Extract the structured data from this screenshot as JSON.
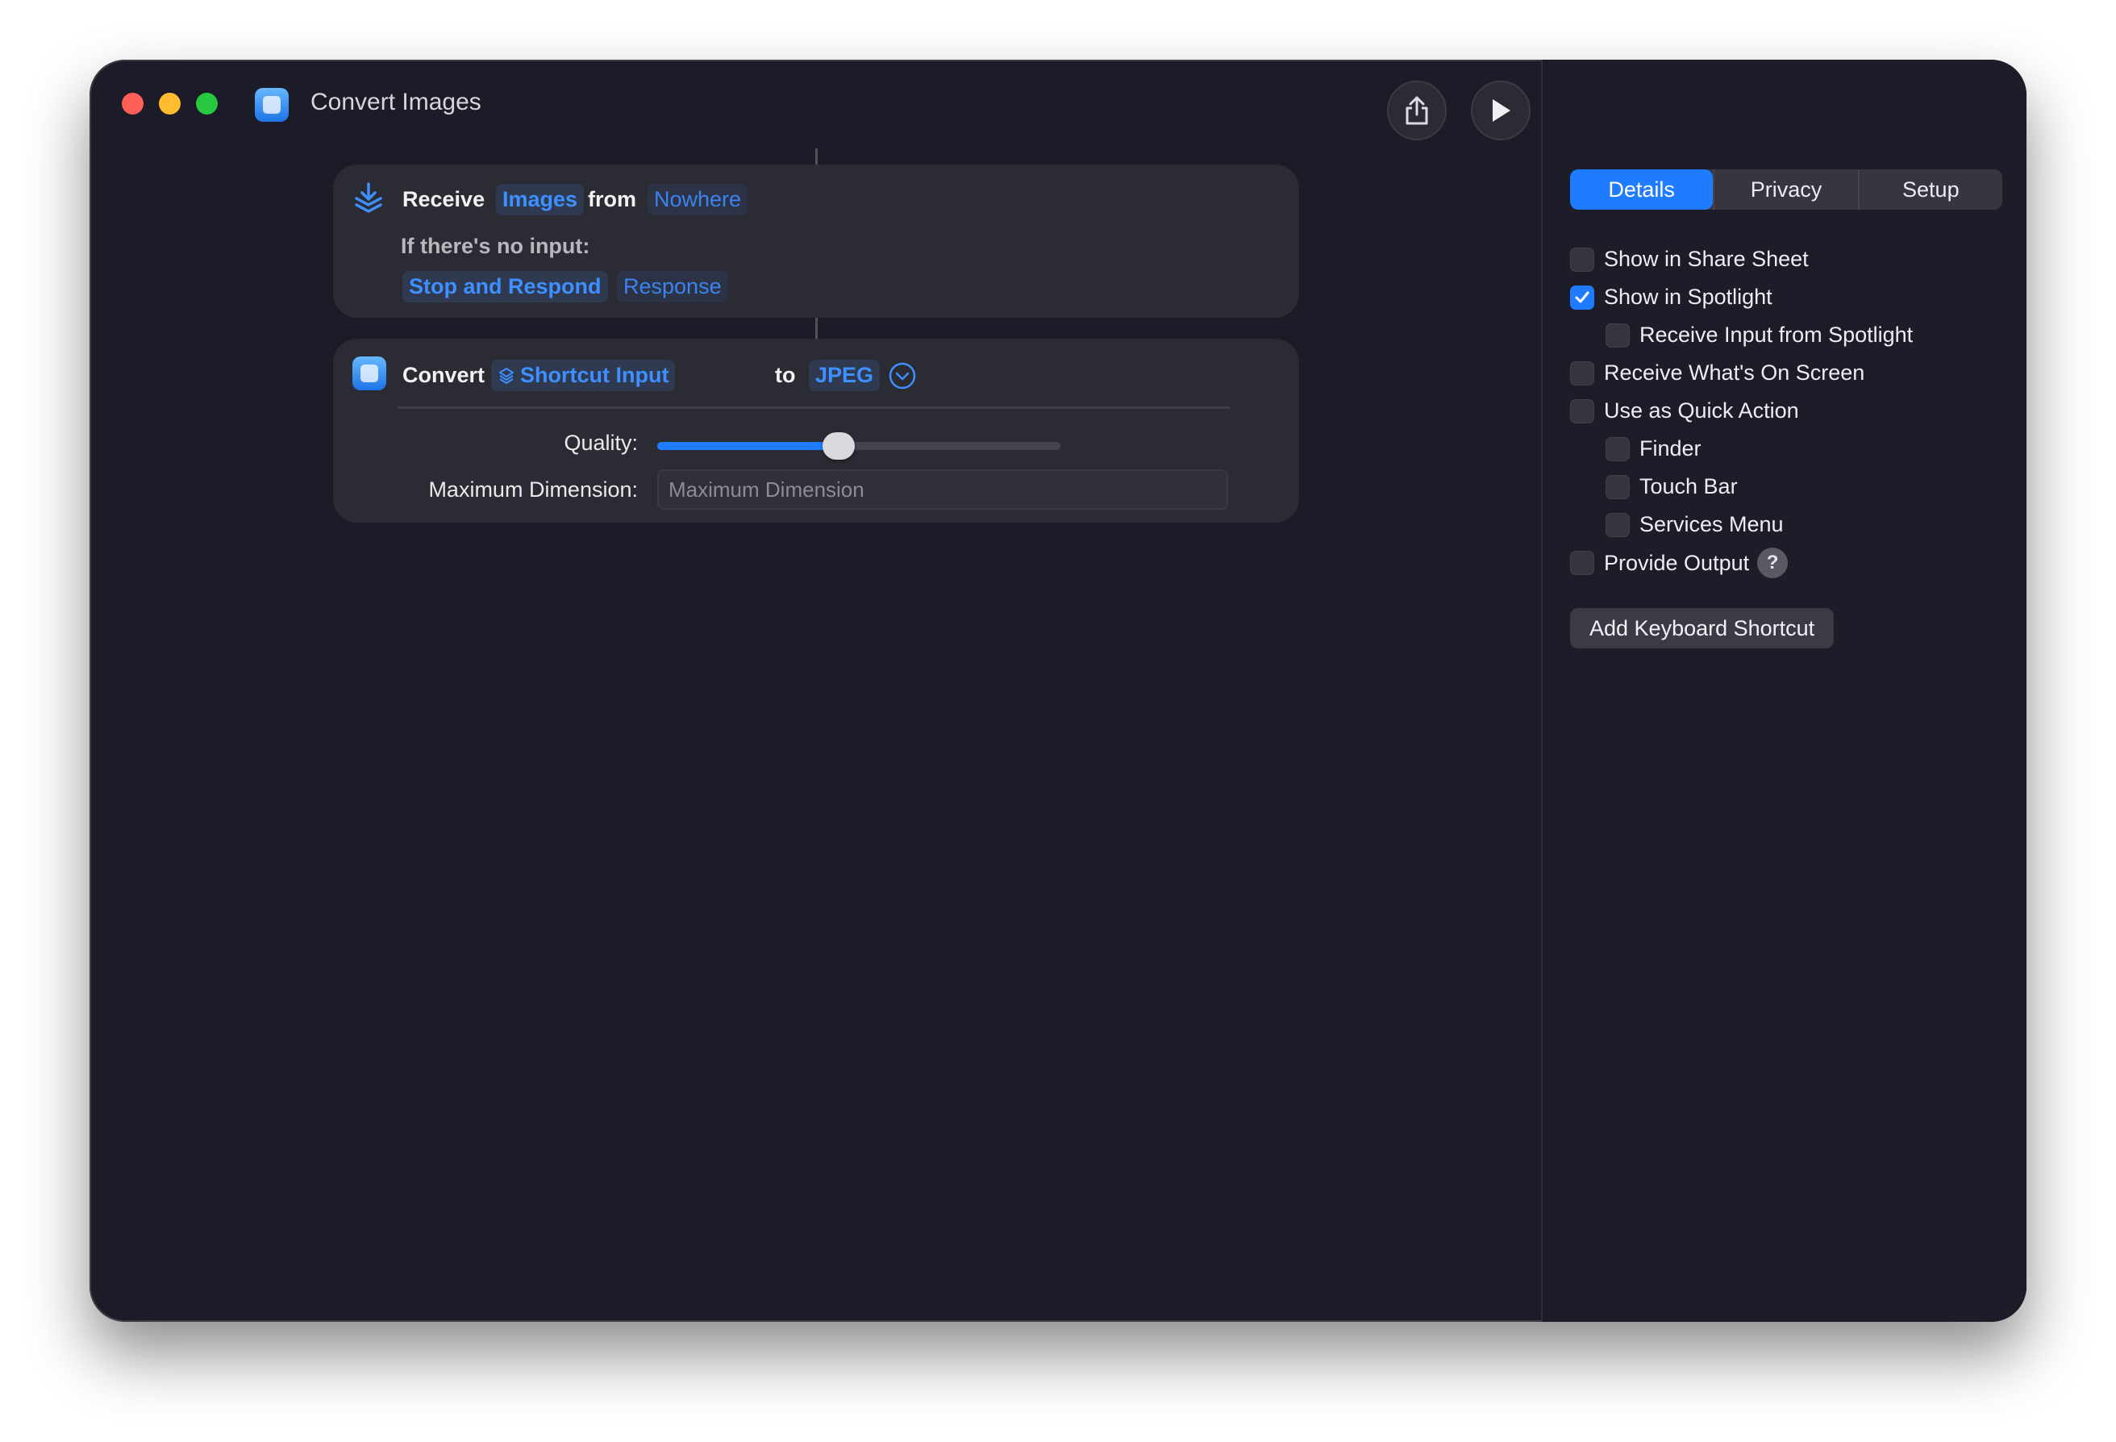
{
  "window": {
    "title": "Convert Images"
  },
  "toolbar": {
    "share_icon": "share-icon",
    "run_icon": "play-icon"
  },
  "inspector_toggle": {
    "library_icon": "library-icon",
    "info_icon": "info-icon"
  },
  "actions": {
    "receive": {
      "verb": "Receive",
      "type": "Images",
      "from_word": "from",
      "source": "Nowhere",
      "no_input_label": "If there's no input:",
      "behavior": "Stop and Respond",
      "response": "Response"
    },
    "convert": {
      "verb": "Convert",
      "input": "Shortcut Input",
      "to_word": "to",
      "format": "JPEG",
      "quality_label": "Quality:",
      "quality_value": 0.45,
      "max_dimension_label": "Maximum Dimension:",
      "max_dimension_placeholder": "Maximum Dimension"
    }
  },
  "sidebar": {
    "tabs": [
      {
        "label": "Details",
        "active": true
      },
      {
        "label": "Privacy",
        "active": false
      },
      {
        "label": "Setup",
        "active": false
      }
    ],
    "options": [
      {
        "label": "Show in Share Sheet",
        "checked": false,
        "indent": 0
      },
      {
        "label": "Show in Spotlight",
        "checked": true,
        "indent": 0
      },
      {
        "label": "Receive Input from Spotlight",
        "checked": false,
        "indent": 1
      },
      {
        "label": "Receive What's On Screen",
        "checked": false,
        "indent": 0
      },
      {
        "label": "Use as Quick Action",
        "checked": false,
        "indent": 0
      },
      {
        "label": "Finder",
        "checked": false,
        "indent": 1
      },
      {
        "label": "Touch Bar",
        "checked": false,
        "indent": 1
      },
      {
        "label": "Services Menu",
        "checked": false,
        "indent": 1
      },
      {
        "label": "Provide Output",
        "checked": false,
        "indent": 0
      }
    ],
    "help_symbol": "?",
    "keyboard_shortcut_button": "Add Keyboard Shortcut"
  },
  "colors": {
    "accent": "#1f7bff",
    "background": "#1b1c27",
    "card": "#2b2c33"
  }
}
